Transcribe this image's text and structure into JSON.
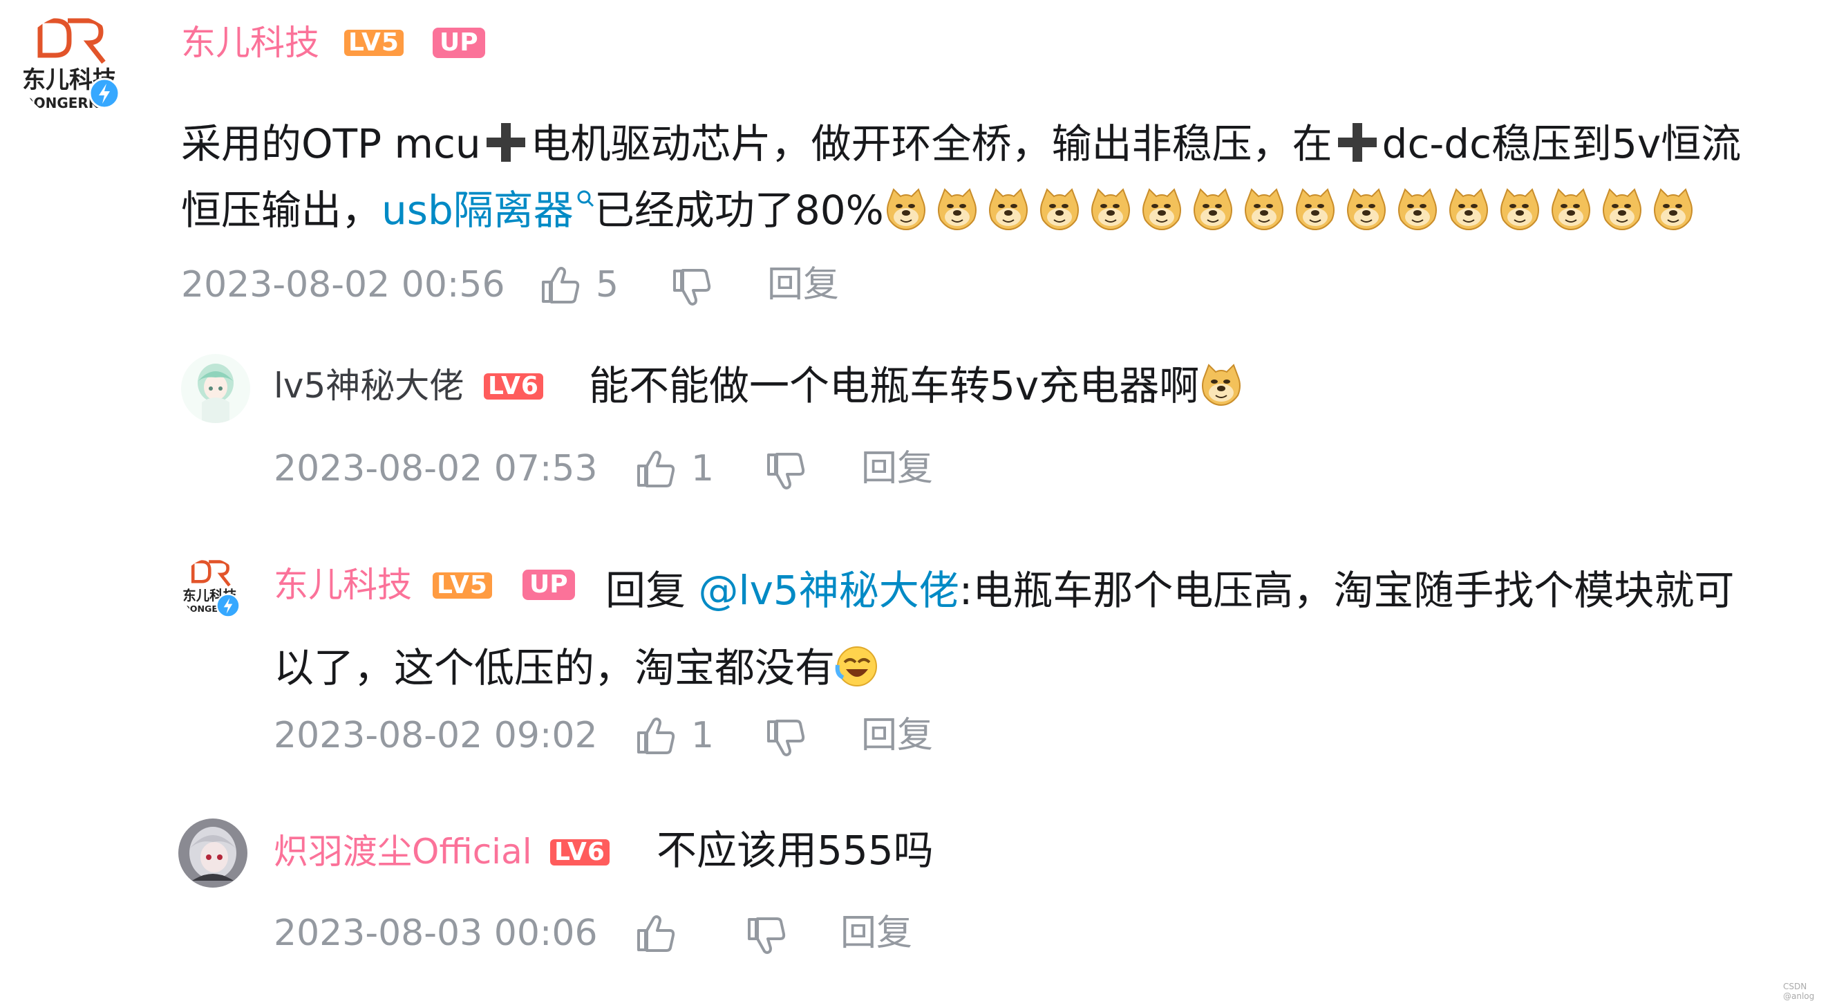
{
  "comments": [
    {
      "username": "东儿科技",
      "level": "LV5",
      "up_badge": "UP",
      "avatar_text": "东儿科技",
      "avatar_sub": "DONGERK",
      "content_part1": "采用的OTP mcu",
      "content_part2": "电机驱动芯片，做开环全桥，输出非稳压，在",
      "content_part3": "dc-dc稳压到5v恒流",
      "content_line2_start": "恒压输出，",
      "content_link": "usb隔离器",
      "content_line2_end": "已经成功了80%",
      "emoji_count": 16,
      "time": "2023-08-02 00:56",
      "likes": "5",
      "reply_label": "回复"
    },
    {
      "username": "lv5神秘大佬",
      "level": "LV6",
      "content": "能不能做一个电瓶车转5v充电器啊",
      "time": "2023-08-02 07:53",
      "likes": "1",
      "reply_label": "回复"
    },
    {
      "username": "东儿科技",
      "level": "LV5",
      "up_badge": "UP",
      "avatar_text": "东儿科技",
      "avatar_sub": "DONGE",
      "reply_prefix": "回复",
      "mention": "@lv5神秘大佬",
      "content_line1": ":电瓶车那个电压高，淘宝随手找个模块就可",
      "content_line2": "以了，这个低压的，淘宝都没有",
      "time": "2023-08-02 09:02",
      "likes": "1",
      "reply_label": "回复"
    },
    {
      "username": "炽羽渡尘Official",
      "level": "LV6",
      "content": "不应该用555吗",
      "time": "2023-08-03 00:06",
      "likes": "",
      "reply_label": "回复"
    }
  ],
  "watermark": "CSDN @anlog",
  "colors": {
    "pink": "#fb7299",
    "link": "#008ac5",
    "meta_gray": "#9499a0",
    "lv5": "#ff9b41",
    "lv6": "#ff5c5c"
  }
}
